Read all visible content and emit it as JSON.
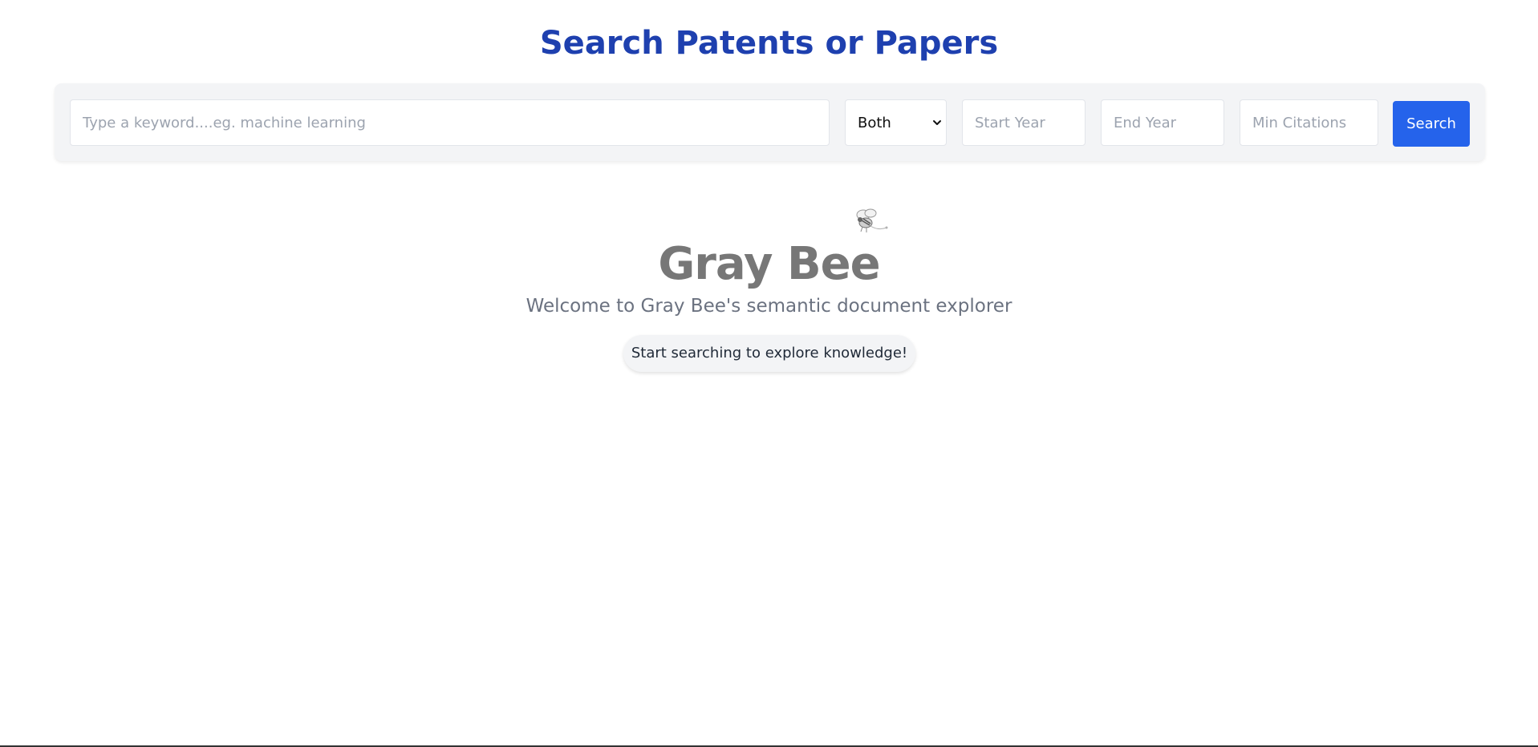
{
  "header": {
    "title": "Search Patents or Papers"
  },
  "search": {
    "keyword_placeholder": "Type a keyword....eg. machine learning",
    "keyword_value": "",
    "type_selected": "Both",
    "start_year_placeholder": "Start Year",
    "end_year_placeholder": "End Year",
    "min_citations_placeholder": "Min Citations",
    "button_label": "Search"
  },
  "hero": {
    "brand": "Gray Bee",
    "welcome": "Welcome to Gray Bee's semantic document explorer",
    "cta": "Start searching to explore knowledge!",
    "icon": "bee-icon"
  },
  "colors": {
    "title": "#1e40af",
    "accent": "#2563eb",
    "panel_bg": "#f3f4f6",
    "brand_text": "#777777",
    "muted_text": "#6b7280"
  }
}
